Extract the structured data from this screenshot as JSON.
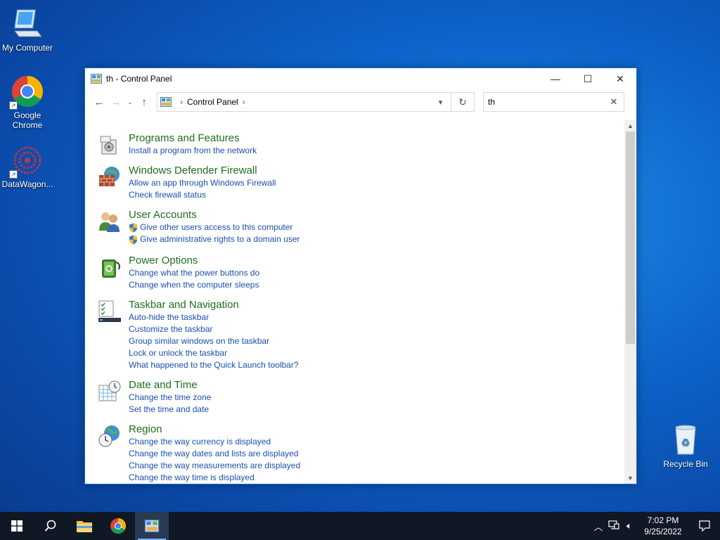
{
  "desktop": {
    "icons": [
      {
        "label": "My Computer"
      },
      {
        "label": "Google Chrome"
      },
      {
        "label": "DataWagon..."
      },
      {
        "label": "Recycle Bin"
      }
    ]
  },
  "window": {
    "title": "th - Control Panel",
    "address": {
      "path": "Control Panel"
    },
    "search": {
      "value": "th"
    },
    "groups": [
      {
        "title": "Programs and Features",
        "icon": "programs-icon",
        "links": [
          "Install a program from the network"
        ]
      },
      {
        "title": "Windows Defender Firewall",
        "icon": "firewall-icon",
        "links": [
          "Allow an app through Windows Firewall",
          "Check firewall status"
        ]
      },
      {
        "title": "User Accounts",
        "icon": "users-icon",
        "links": [
          "Give other users access to this computer",
          "Give administrative rights to a domain user"
        ]
      },
      {
        "title": "Power Options",
        "icon": "power-icon",
        "links": [
          "Change what the power buttons do",
          "Change when the computer sleeps"
        ]
      },
      {
        "title": "Taskbar and Navigation",
        "icon": "taskbar-icon",
        "links": [
          "Auto-hide the taskbar",
          "Customize the taskbar",
          "Group similar windows on the taskbar",
          "Lock or unlock the taskbar",
          "What happened to the Quick Launch toolbar?"
        ]
      },
      {
        "title": "Date and Time",
        "icon": "clock-icon",
        "links": [
          "Change the time zone",
          "Set the time and date"
        ]
      },
      {
        "title": "Region",
        "icon": "region-icon",
        "links": [
          "Change the way currency is displayed",
          "Change the way dates and lists are displayed",
          "Change the way measurements are displayed",
          "Change the way time is displayed"
        ]
      }
    ]
  },
  "taskbar": {
    "time": "7:02 PM",
    "date": "9/25/2022"
  },
  "colors": {
    "group_title": "#1e6e1e",
    "link": "#1a4fb0",
    "taskbar": "#101826"
  }
}
